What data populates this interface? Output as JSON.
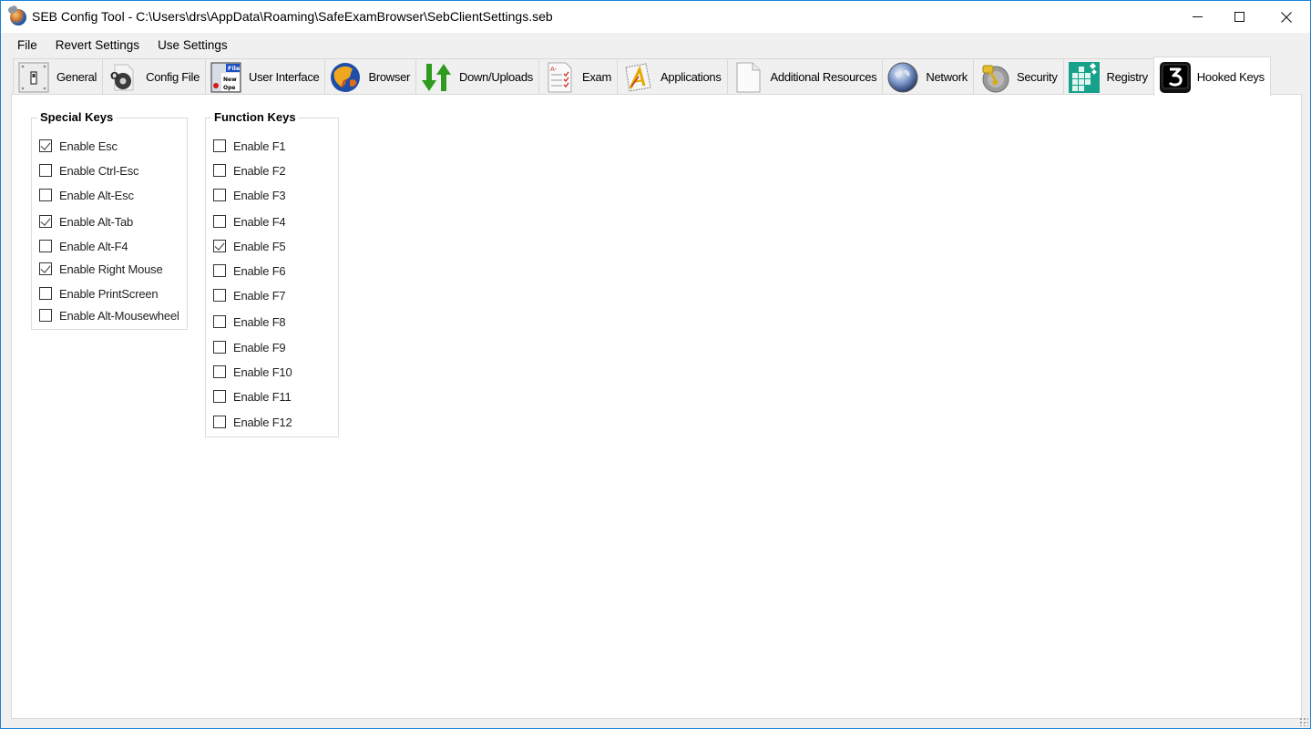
{
  "window": {
    "title": "SEB Config Tool - C:\\Users\\drs\\AppData\\Roaming\\SafeExamBrowser\\SebClientSettings.seb",
    "controls": {
      "minimize": "minimize",
      "maximize": "maximize",
      "close": "close"
    }
  },
  "menu": {
    "items": [
      {
        "label": "File"
      },
      {
        "label": "Revert Settings"
      },
      {
        "label": "Use Settings"
      }
    ]
  },
  "tabs": [
    {
      "label": "General",
      "icon": "switch-icon",
      "active": false
    },
    {
      "label": "Config File",
      "icon": "config-file-icon",
      "active": false
    },
    {
      "label": "User Interface",
      "icon": "user-interface-icon",
      "active": false
    },
    {
      "label": "Browser",
      "icon": "browser-globe-icon",
      "active": false
    },
    {
      "label": "Down/Uploads",
      "icon": "down-up-arrows-icon",
      "active": false
    },
    {
      "label": "Exam",
      "icon": "exam-checklist-icon",
      "active": false
    },
    {
      "label": "Applications",
      "icon": "applications-icon",
      "active": false
    },
    {
      "label": "Additional Resources",
      "icon": "document-icon",
      "active": false
    },
    {
      "label": "Network",
      "icon": "network-globe-icon",
      "active": false
    },
    {
      "label": "Security",
      "icon": "security-key-icon",
      "active": false
    },
    {
      "label": "Registry",
      "icon": "registry-icon",
      "active": false
    },
    {
      "label": "Hooked Keys",
      "icon": "hooked-keys-icon",
      "active": true
    }
  ],
  "special_keys": {
    "title": "Special Keys",
    "items": [
      {
        "label": "Enable Esc",
        "checked": true
      },
      {
        "label": "Enable Ctrl-Esc",
        "checked": false
      },
      {
        "label": "Enable Alt-Esc",
        "checked": false
      },
      {
        "label": "Enable Alt-Tab",
        "checked": true
      },
      {
        "label": "Enable Alt-F4",
        "checked": false
      },
      {
        "label": "Enable Right Mouse",
        "checked": true
      },
      {
        "label": "Enable PrintScreen",
        "checked": false
      },
      {
        "label": "Enable Alt-Mousewheel",
        "checked": false
      }
    ]
  },
  "function_keys": {
    "title": "Function Keys",
    "items": [
      {
        "label": "Enable F1",
        "checked": false
      },
      {
        "label": "Enable F2",
        "checked": false
      },
      {
        "label": "Enable F3",
        "checked": false
      },
      {
        "label": "Enable F4",
        "checked": false
      },
      {
        "label": "Enable F5",
        "checked": true
      },
      {
        "label": "Enable F6",
        "checked": false
      },
      {
        "label": "Enable F7",
        "checked": false
      },
      {
        "label": "Enable F8",
        "checked": false
      },
      {
        "label": "Enable F9",
        "checked": false
      },
      {
        "label": "Enable F10",
        "checked": false
      },
      {
        "label": "Enable F11",
        "checked": false
      },
      {
        "label": "Enable F12",
        "checked": false
      }
    ]
  },
  "colors": {
    "window_border": "#1883d7",
    "panel_bg": "#ffffff",
    "chrome_bg": "#f0f0f0"
  }
}
